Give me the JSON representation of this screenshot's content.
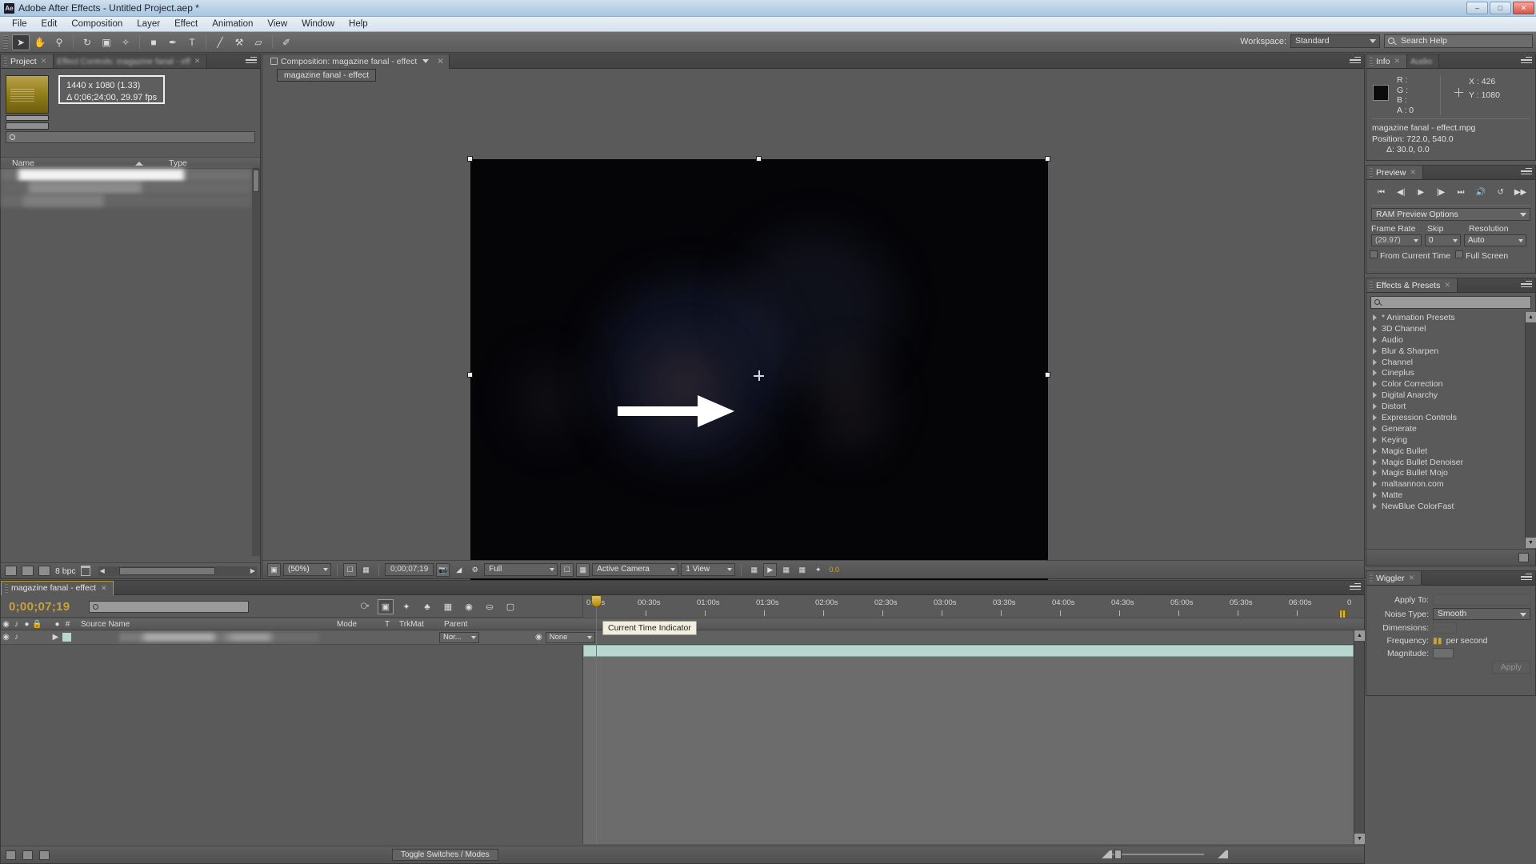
{
  "window": {
    "title": "Adobe After Effects - Untitled Project.aep *",
    "app_badge": "Ae",
    "minimize": "–",
    "maximize": "□",
    "close": "✕"
  },
  "menu": [
    "File",
    "Edit",
    "Composition",
    "Layer",
    "Effect",
    "Animation",
    "View",
    "Window",
    "Help"
  ],
  "toolbar": {
    "tools": [
      {
        "name": "selection-tool",
        "glyph": "➤"
      },
      {
        "name": "hand-tool",
        "glyph": "✋"
      },
      {
        "name": "zoom-tool",
        "glyph": "⚲"
      },
      {
        "name": "rotation-tool",
        "glyph": "↻"
      },
      {
        "name": "camera-tool",
        "glyph": "▣"
      },
      {
        "name": "pan-behind-tool",
        "glyph": "✧"
      },
      {
        "name": "shape-tool",
        "glyph": "■"
      },
      {
        "name": "pen-tool",
        "glyph": "✒"
      },
      {
        "name": "type-tool",
        "glyph": "T"
      },
      {
        "name": "brush-tool",
        "glyph": "╱"
      },
      {
        "name": "clone-stamp-tool",
        "glyph": "⚒"
      },
      {
        "name": "eraser-tool",
        "glyph": "▱"
      },
      {
        "name": "roto-brush-tool",
        "glyph": "✐"
      }
    ],
    "workspace_label": "Workspace:",
    "workspace_value": "Standard",
    "search_help_placeholder": "Search Help"
  },
  "project": {
    "tabs": [
      {
        "label": "Project",
        "selected": true
      },
      {
        "label": "Effect Controls: magazine fanal - eff",
        "selected": false
      }
    ],
    "item_meta_line1": "1440 x 1080 (1.33)",
    "item_meta_line2": "Δ 0;06;24;00, 29.97 fps",
    "columns": {
      "name": "Name",
      "type": "Type"
    },
    "footer": {
      "bit_depth": "8 bpc"
    }
  },
  "composition": {
    "tab_label": "Composition: magazine fanal - effect",
    "sub_tab_label": "magazine fanal - effect",
    "toolbar": {
      "zoom": "(50%)",
      "timecode": "0;00;07;19",
      "resolution": "Full",
      "camera": "Active Camera",
      "views": "1 View",
      "exposure": "0.0"
    }
  },
  "info": {
    "tabs": [
      {
        "label": "Info",
        "selected": true
      },
      {
        "label": "Audio",
        "selected": false
      }
    ],
    "channels": [
      {
        "label": "R :",
        "value": ""
      },
      {
        "label": "G :",
        "value": ""
      },
      {
        "label": "B :",
        "value": ""
      },
      {
        "label": "A :",
        "value": "0"
      }
    ],
    "x_label": "X : 426",
    "y_label": "Y : 1080",
    "layer_name": "magazine fanal - effect.mpg",
    "position": "Position: 722.0, 540.0",
    "delta": "Δ: 30.0, 0.0"
  },
  "preview": {
    "tab_label": "Preview",
    "transport": [
      {
        "name": "first-frame-button",
        "glyph": "⏮"
      },
      {
        "name": "previous-frame-button",
        "glyph": "◀|"
      },
      {
        "name": "play-button",
        "glyph": "▶"
      },
      {
        "name": "next-frame-button",
        "glyph": "|▶"
      },
      {
        "name": "last-frame-button",
        "glyph": "⏭"
      },
      {
        "name": "audio-button",
        "glyph": "🔊"
      },
      {
        "name": "loop-button",
        "glyph": "↺"
      },
      {
        "name": "ram-preview-button",
        "glyph": "▶▶"
      }
    ],
    "ram_preview_options": "RAM Preview Options",
    "frame_rate_label": "Frame Rate",
    "skip_label": "Skip",
    "resolution_label": "Resolution",
    "frame_rate_value": "(29.97)",
    "skip_value": "0",
    "resolution_value": "Auto",
    "from_current_time": "From Current Time",
    "full_screen": "Full Screen"
  },
  "effects_presets": {
    "tab_label": "Effects & Presets",
    "search_placeholder": "",
    "items": [
      "* Animation Presets",
      "3D Channel",
      "Audio",
      "Blur & Sharpen",
      "Channel",
      "Cineplus",
      "Color Correction",
      "Digital Anarchy",
      "Distort",
      "Expression Controls",
      "Generate",
      "Keying",
      "Magic Bullet",
      "Magic Bullet Denoiser",
      "Magic Bullet Mojo",
      "maltaannon.com",
      "Matte",
      "NewBlue ColorFast"
    ]
  },
  "wiggler": {
    "tab_label": "Wiggler",
    "apply_to_label": "Apply To:",
    "apply_to_value": "",
    "noise_type_label": "Noise Type:",
    "noise_type_value": "Smooth",
    "dimensions_label": "Dimensions:",
    "frequency_label": "Frequency:",
    "frequency_unit": "per second",
    "magnitude_label": "Magnitude:",
    "apply_button": "Apply"
  },
  "timeline": {
    "tab_label": "magazine fanal - effect",
    "current_timecode": "0;00;07;19",
    "search_placeholder": "",
    "columns": {
      "source_name": "Source Name",
      "mode": "Mode",
      "t": "T",
      "trkmat": "TrkMat",
      "parent": "Parent"
    },
    "layer": {
      "mode_value": "Nor...",
      "parent_value": "None"
    },
    "ruler_labels": [
      "0:00s",
      "00:30s",
      "01:00s",
      "01:30s",
      "02:00s",
      "02:30s",
      "03:00s",
      "03:30s",
      "04:00s",
      "04:30s",
      "05:00s",
      "05:30s",
      "06:00s",
      "0"
    ],
    "tooltip": "Current Time Indicator",
    "toggle_switches_modes": "Toggle Switches / Modes"
  }
}
